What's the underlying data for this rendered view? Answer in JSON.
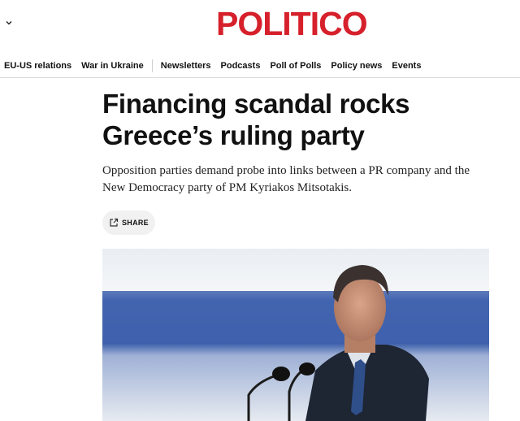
{
  "header": {
    "logo_text": "POLITICO",
    "brand_color": "#d6202b"
  },
  "nav": {
    "left_items": [
      {
        "label": "EU-US relations"
      },
      {
        "label": "War in Ukraine"
      }
    ],
    "right_items": [
      {
        "label": "Newsletters"
      },
      {
        "label": "Podcasts"
      },
      {
        "label": "Poll of Polls"
      },
      {
        "label": "Policy news"
      },
      {
        "label": "Events"
      }
    ]
  },
  "article": {
    "headline": "Financing scandal rocks Greece’s ruling party",
    "dek": "Opposition parties demand probe into links between a PR company and the New Democracy party of PM Kyriakos Mitsotakis.",
    "share_label": "SHARE"
  },
  "icons": {
    "menu_toggle": "chevron-down-icon",
    "share": "share-icon"
  }
}
